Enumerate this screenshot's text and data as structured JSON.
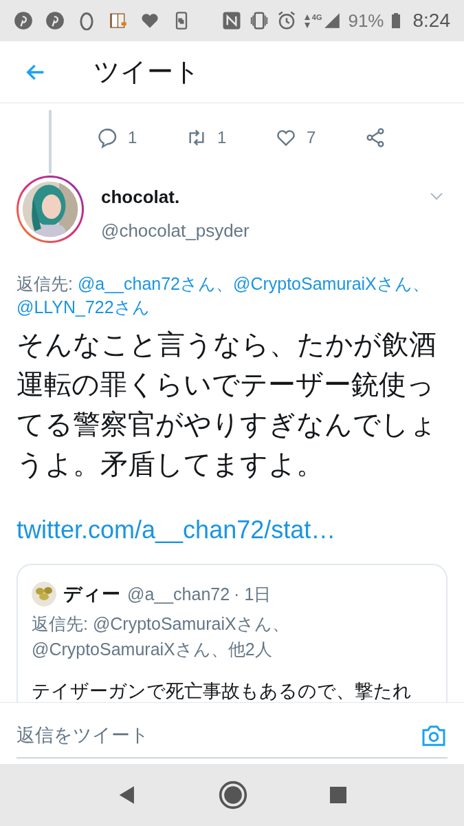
{
  "status_bar": {
    "battery": "91%",
    "time": "8:24",
    "network": "4G"
  },
  "header": {
    "title": "ツイート"
  },
  "previous_tweet": {
    "actions": [
      {
        "kind": "reply",
        "count": "1"
      },
      {
        "kind": "retweet",
        "count": "1"
      },
      {
        "kind": "like",
        "count": "7"
      },
      {
        "kind": "share"
      }
    ]
  },
  "tweet": {
    "name": "chocolat.",
    "handle": "@chocolat_psyder",
    "reply_label": "返信先:",
    "reply_to": "@a__chan72さん、@CryptoSamuraiXさん、@LLYN_722さん",
    "text": "そんなこと言うなら、たかが飲酒運転の罪くらいでテーザー銃使ってる警察官がやりすぎなんでしょうよ。矛盾してますよ。",
    "link": "twitter.com/a__chan72/stat…",
    "quote": {
      "name": "ディー",
      "handle": "@a__chan72",
      "time": "· 1日",
      "reply_to": "返信先: @CryptoSamuraiXさん、@CryptoSamuraiXさん、他2人",
      "text": "テイザーガンで死亡事故もあるので、撃たれ"
    }
  },
  "reply_bar": {
    "placeholder": "返信をツイート"
  }
}
